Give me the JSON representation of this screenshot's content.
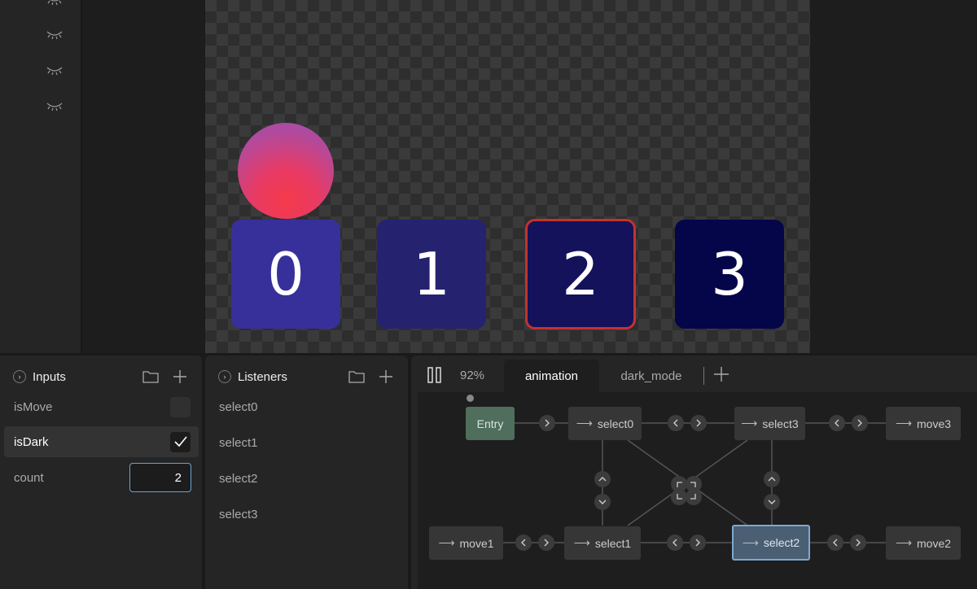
{
  "canvas": {
    "boxes": [
      "0",
      "1",
      "2",
      "3"
    ]
  },
  "inputs_panel": {
    "title": "Inputs",
    "rows": [
      {
        "label": "isMove",
        "type": "boolean",
        "checked": false
      },
      {
        "label": "isDark",
        "type": "boolean",
        "checked": true
      },
      {
        "label": "count",
        "type": "number",
        "value": "2"
      }
    ]
  },
  "listeners_panel": {
    "title": "Listeners",
    "items": [
      "select0",
      "select1",
      "select2",
      "select3"
    ]
  },
  "graph_panel": {
    "zoom": "92%",
    "tabs": [
      "animation",
      "dark_mode"
    ],
    "active_tab": "animation",
    "nodes": {
      "entry": "Entry",
      "select0": "select0",
      "select1": "select1",
      "select2": "select2",
      "select3": "select3",
      "move1": "move1",
      "move2": "move2",
      "move3": "move3"
    },
    "selected_node": "select2"
  },
  "colors": {
    "box0": "#37309a",
    "box1": "#252370",
    "box2": "#13125a",
    "box3": "#05054a",
    "selected_outline": "#c3322f",
    "entry_node": "#4f6e5b",
    "selected_node": "#4a5f74",
    "focus_border": "#6aa2d6"
  }
}
